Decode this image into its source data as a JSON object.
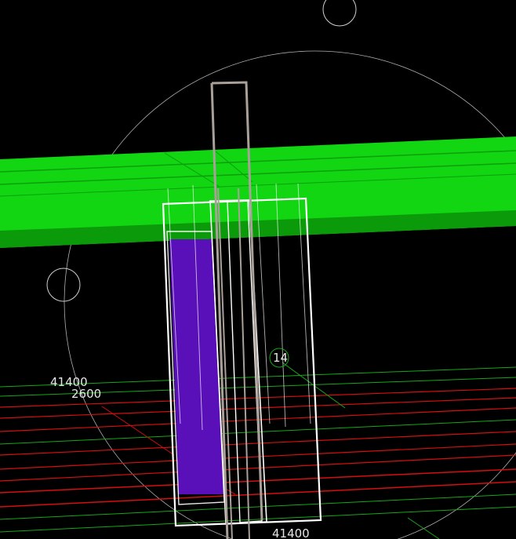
{
  "scene": {
    "colors": {
      "background": "#000000",
      "beam": "#12d612",
      "beam_dark": "#0a8f0a",
      "column_fill": "#5a10b8",
      "outline": "#ffffff",
      "post": "#a9a09a",
      "red_grid": "#d40f0f",
      "green_grid": "#17a617",
      "circle": "#cfcfcf"
    },
    "labels": {
      "dim_left_top": "41400",
      "dim_left_bottom": "2600",
      "dim_bottom": "41400",
      "marker_id": "14"
    }
  }
}
